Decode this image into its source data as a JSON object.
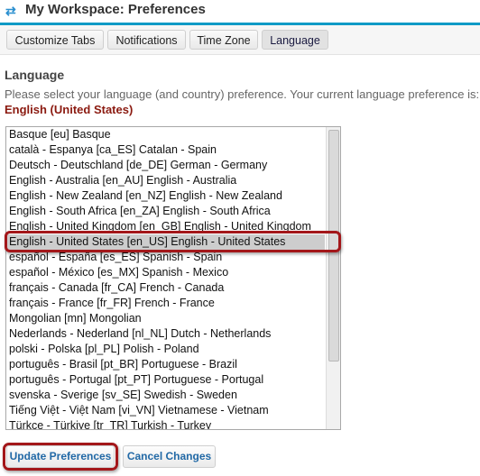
{
  "header": {
    "icon": "refresh-arrows-icon",
    "title": "My Workspace: Preferences"
  },
  "tabs": [
    {
      "label": "Customize Tabs",
      "active": false
    },
    {
      "label": "Notifications",
      "active": false
    },
    {
      "label": "Time Zone",
      "active": false
    },
    {
      "label": "Language",
      "active": true
    }
  ],
  "section": {
    "heading": "Language",
    "description": "Please select your language (and country) preference. Your current language preference is:",
    "current_value": "English (United States)"
  },
  "language_list": {
    "selected_index": 7,
    "options": [
      "Basque [eu] Basque",
      "català - Espanya [ca_ES] Catalan - Spain",
      "Deutsch - Deutschland [de_DE] German - Germany",
      "English - Australia [en_AU] English - Australia",
      "English - New Zealand [en_NZ] English - New Zealand",
      "English - South Africa [en_ZA] English - South Africa",
      "English - United Kingdom [en_GB] English - United Kingdom",
      "English - United States [en_US] English - United States",
      "español - España [es_ES] Spanish - Spain",
      "español - México [es_MX] Spanish - Mexico",
      "français - Canada [fr_CA] French - Canada",
      "français - France [fr_FR] French - France",
      "Mongolian [mn] Mongolian",
      "Nederlands - Nederland [nl_NL] Dutch - Netherlands",
      "polski - Polska [pl_PL] Polish - Poland",
      "português - Brasil [pt_BR] Portuguese - Brazil",
      "português - Portugal [pt_PT] Portuguese - Portugal",
      "svenska - Sverige [sv_SE] Swedish - Sweden",
      "Tiếng Việt - Việt Nam [vi_VN] Vietnamese - Vietnam",
      "Türkçe - Türkiye [tr_TR] Turkish - Turkey"
    ]
  },
  "actions": {
    "update_label": "Update Preferences",
    "cancel_label": "Cancel Changes"
  },
  "colors": {
    "accent": "#0f9ac6",
    "current_value": "#8b1a10",
    "button_text": "#2269a6",
    "annotation": "#a3171a"
  }
}
